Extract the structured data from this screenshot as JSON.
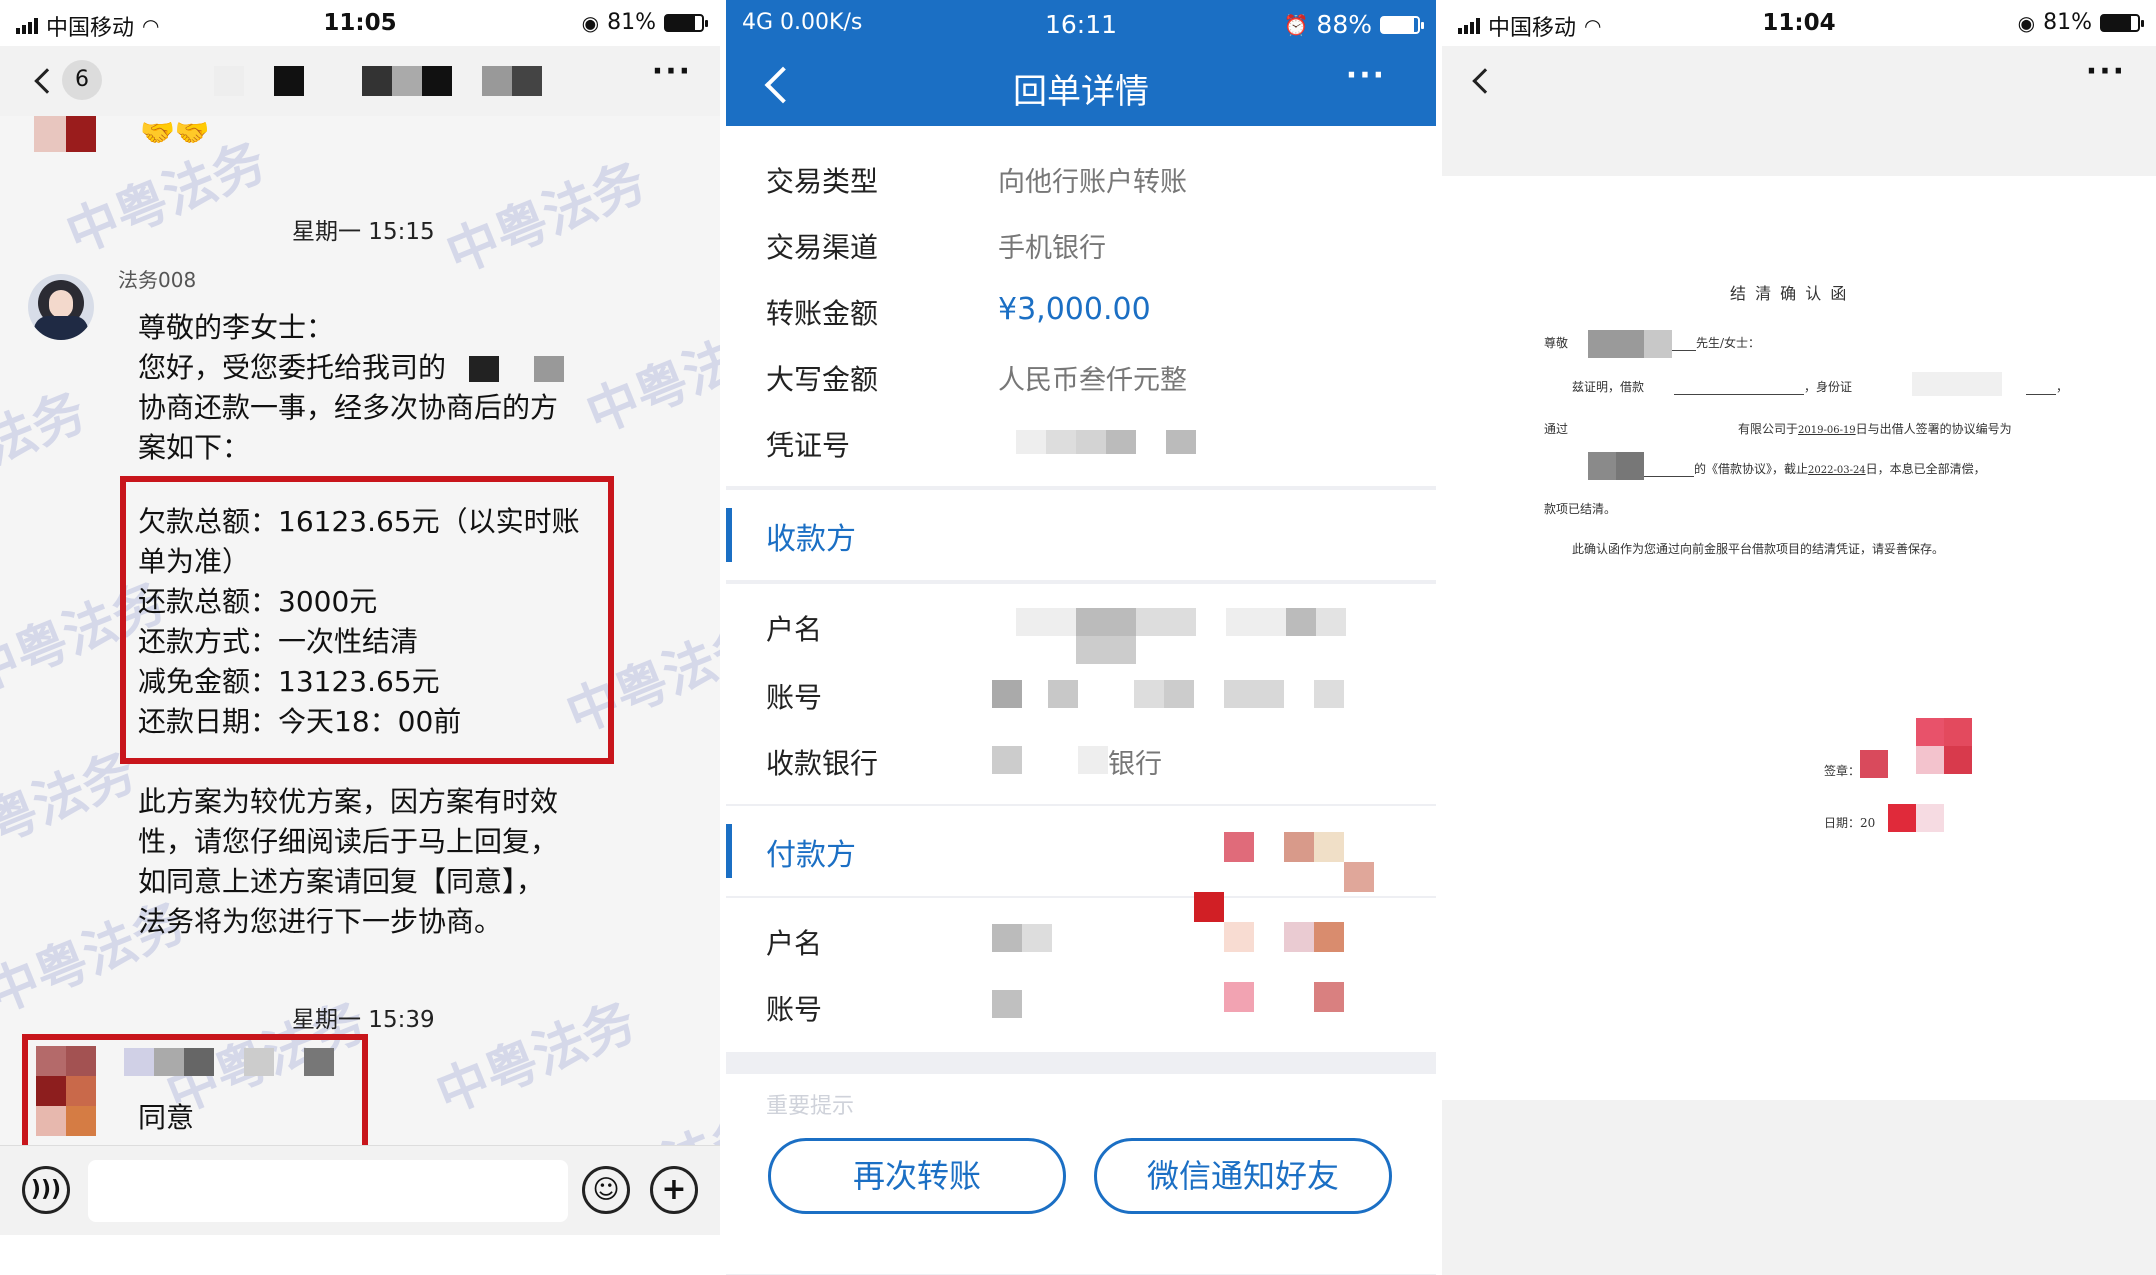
{
  "chat": {
    "status": {
      "carrier": "中国移动",
      "time": "11:05",
      "battery": "81%"
    },
    "unread_count": "6",
    "messages": {
      "time1": "星期一 15:15",
      "sender": "法务008",
      "greeting": "尊敬的李女士：",
      "intro_1": "您好，受您委托给我司的",
      "intro_2": "协商还款一事，经多次协商后的方",
      "intro_3": "案如下：",
      "plan": [
        "欠款总额：16123.65元（以实时账",
        "单为准）",
        "还款总额：3000元",
        "还款方式：一次性结清",
        "减免金额：13123.65元",
        "还款日期：今天18：00前"
      ],
      "note": [
        "此方案为较优方案，因方案有时效",
        "性，请您仔细阅读后于马上回复，",
        "如同意上述方案请回复【同意】，",
        "法务将为您进行下一步协商。"
      ],
      "time2": "星期一 15:39",
      "reply": "同意"
    },
    "watermark": "中粤法务",
    "input": {
      "placeholder": ""
    }
  },
  "receipt": {
    "status": {
      "network": "4G 0.00K/s",
      "time": "16:11",
      "battery": "88%"
    },
    "title": "回单详情",
    "rows": [
      {
        "label": "交易类型",
        "value": "向他行账户转账"
      },
      {
        "label": "交易渠道",
        "value": "手机银行"
      },
      {
        "label": "转账金额",
        "value": "¥3,000.00"
      },
      {
        "label": "大写金额",
        "value": "人民币叁仟元整"
      },
      {
        "label": "凭证号",
        "value": ""
      }
    ],
    "payee_section": "收款方",
    "payee_rows": [
      {
        "label": "户名"
      },
      {
        "label": "账号"
      },
      {
        "label": "收款银行",
        "value": "银行"
      }
    ],
    "payer_section": "付款方",
    "payer_rows": [
      {
        "label": "户名"
      },
      {
        "label": "账号"
      }
    ],
    "notice": "重要提示",
    "buttons": {
      "retransfer": "再次转账",
      "notify": "微信通知好友"
    },
    "accent": "#1b6fc4"
  },
  "document": {
    "status": {
      "carrier": "中国移动",
      "time": "11:04",
      "battery": "81%"
    },
    "title": "结 清 确 认 函",
    "salutation_prefix": "尊敬",
    "salutation_suffix": "先生/女士：",
    "line1_a": "兹证明，借款",
    "line1_b": "，身份证",
    "line2_a": "通过",
    "line2_b": "有限公司于",
    "line2_date": "2019-06-19",
    "line2_c": "日与出借人签署的协议编号为",
    "line3_a": "的《借款协议》，截止",
    "line3_date": "2022-03-24",
    "line3_b": "日，本息已全部清偿，",
    "line4": "款项已结清。",
    "line5": "此确认函作为您通过向前金服平台借款项目的结清凭证，请妥善保存。",
    "seal_label": "签章：",
    "date_label": "日期：",
    "date_value": "20"
  }
}
